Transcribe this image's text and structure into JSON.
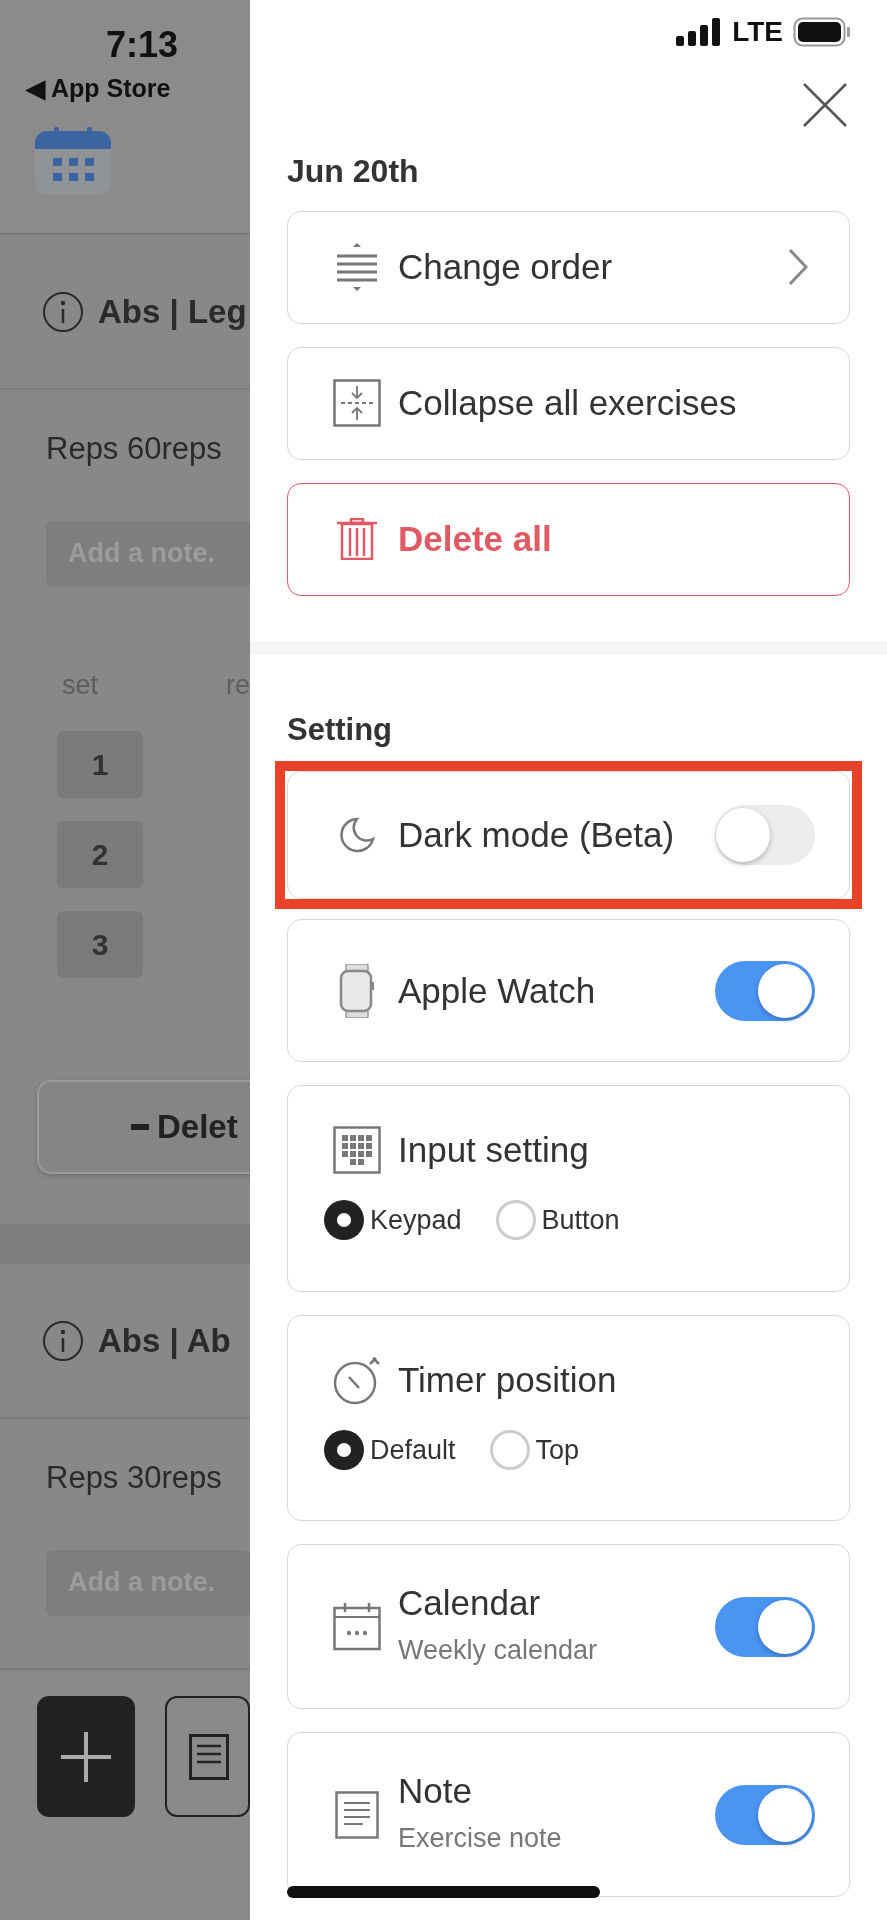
{
  "status_bar": {
    "time": "7:13",
    "back_link": "◀ App Store",
    "network": "LTE"
  },
  "background": {
    "sections": [
      {
        "title": "Abs | Leg",
        "reps": "Reps 60reps",
        "note_placeholder": "Add a note.",
        "set_header": "set",
        "column_2_header": "re",
        "sets": [
          "1",
          "2",
          "3"
        ],
        "delete_button": "Delet"
      },
      {
        "title": "Abs | Ab",
        "reps": "Reps 30reps",
        "note_placeholder": "Add a note."
      }
    ]
  },
  "drawer": {
    "date": "Jun 20th",
    "actions": [
      {
        "kind": "nav",
        "label": "Change order"
      },
      {
        "kind": "plain",
        "label": "Collapse all exercises"
      },
      {
        "kind": "danger",
        "label": "Delete all"
      }
    ],
    "settings_title": "Setting",
    "settings": [
      {
        "kind": "toggle",
        "label": "Dark mode (Beta)",
        "on": false,
        "highlighted": true
      },
      {
        "kind": "toggle",
        "label": "Apple Watch",
        "on": true,
        "highlighted": false
      },
      {
        "kind": "radio",
        "label": "Input setting",
        "highlighted": false,
        "options": [
          {
            "label": "Keypad",
            "selected": true
          },
          {
            "label": "Button",
            "selected": false
          }
        ]
      },
      {
        "kind": "radio",
        "label": "Timer position",
        "highlighted": false,
        "options": [
          {
            "label": "Default",
            "selected": true
          },
          {
            "label": "Top",
            "selected": false
          }
        ]
      },
      {
        "kind": "toggle",
        "label": "Calendar",
        "subtitle": "Weekly calendar",
        "on": true,
        "highlighted": false
      },
      {
        "kind": "toggle",
        "label": "Note",
        "subtitle": "Exercise note",
        "on": true,
        "highlighted": false
      }
    ]
  }
}
